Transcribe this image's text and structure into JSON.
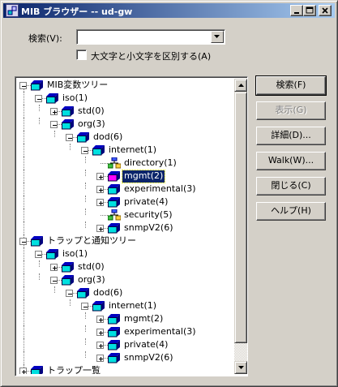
{
  "window": {
    "title": "MIB ブラウザー -- ud-gw",
    "icon": "mib-browser-icon"
  },
  "search": {
    "label": "検索(V):",
    "value": "",
    "case_sensitive_label": "大文字と小文字を区別する(A)",
    "case_sensitive_checked": false
  },
  "tree": {
    "nodes": [
      {
        "label": "MIB変数ツリー",
        "depth": 0,
        "expander": "minus",
        "icon": "folder-node-icon"
      },
      {
        "label": "iso(1)",
        "depth": 1,
        "expander": "minus",
        "icon": "folder-node-icon"
      },
      {
        "label": "std(0)",
        "depth": 2,
        "expander": "plus",
        "icon": "folder-node-icon"
      },
      {
        "label": "org(3)",
        "depth": 2,
        "expander": "minus",
        "icon": "folder-node-icon"
      },
      {
        "label": "dod(6)",
        "depth": 3,
        "expander": "minus",
        "icon": "folder-node-icon"
      },
      {
        "label": "internet(1)",
        "depth": 4,
        "expander": "minus",
        "icon": "folder-node-icon"
      },
      {
        "label": "directory(1)",
        "depth": 5,
        "expander": "none",
        "icon": "network-leaf-icon"
      },
      {
        "label": "mgmt(2)",
        "depth": 5,
        "expander": "plus",
        "icon": "folder-node-icon",
        "selected": true
      },
      {
        "label": "experimental(3)",
        "depth": 5,
        "expander": "plus",
        "icon": "folder-node-icon"
      },
      {
        "label": "private(4)",
        "depth": 5,
        "expander": "plus",
        "icon": "folder-node-icon"
      },
      {
        "label": "security(5)",
        "depth": 5,
        "expander": "none",
        "icon": "network-leaf-icon"
      },
      {
        "label": "snmpV2(6)",
        "depth": 5,
        "expander": "plus",
        "icon": "folder-node-icon"
      },
      {
        "label": "トラップと通知ツリー",
        "depth": 0,
        "expander": "minus",
        "icon": "folder-node-icon"
      },
      {
        "label": "iso(1)",
        "depth": 1,
        "expander": "minus",
        "icon": "folder-node-icon"
      },
      {
        "label": "std(0)",
        "depth": 2,
        "expander": "plus",
        "icon": "folder-node-icon"
      },
      {
        "label": "org(3)",
        "depth": 2,
        "expander": "minus",
        "icon": "folder-node-icon"
      },
      {
        "label": "dod(6)",
        "depth": 3,
        "expander": "minus",
        "icon": "folder-node-icon"
      },
      {
        "label": "internet(1)",
        "depth": 4,
        "expander": "minus",
        "icon": "folder-node-icon"
      },
      {
        "label": "mgmt(2)",
        "depth": 5,
        "expander": "plus",
        "icon": "folder-node-icon"
      },
      {
        "label": "experimental(3)",
        "depth": 5,
        "expander": "plus",
        "icon": "folder-node-icon"
      },
      {
        "label": "private(4)",
        "depth": 5,
        "expander": "plus",
        "icon": "folder-node-icon"
      },
      {
        "label": "snmpV2(6)",
        "depth": 5,
        "expander": "plus",
        "icon": "folder-node-icon"
      },
      {
        "label": "トラップ一覧",
        "depth": 0,
        "expander": "plus",
        "icon": "folder-node-icon"
      }
    ]
  },
  "buttons": {
    "search": "検索(F)",
    "view": "表示(G)",
    "details": "詳細(D)...",
    "walk": "Walk(W)...",
    "close": "閉じる(C)",
    "help": "ヘルプ(H)"
  },
  "colors": {
    "node_cyan": "#00e0e0",
    "node_blue": "#0000c0",
    "node_selected_magenta": "#ff00ff",
    "selection_bg": "#0a246a"
  }
}
